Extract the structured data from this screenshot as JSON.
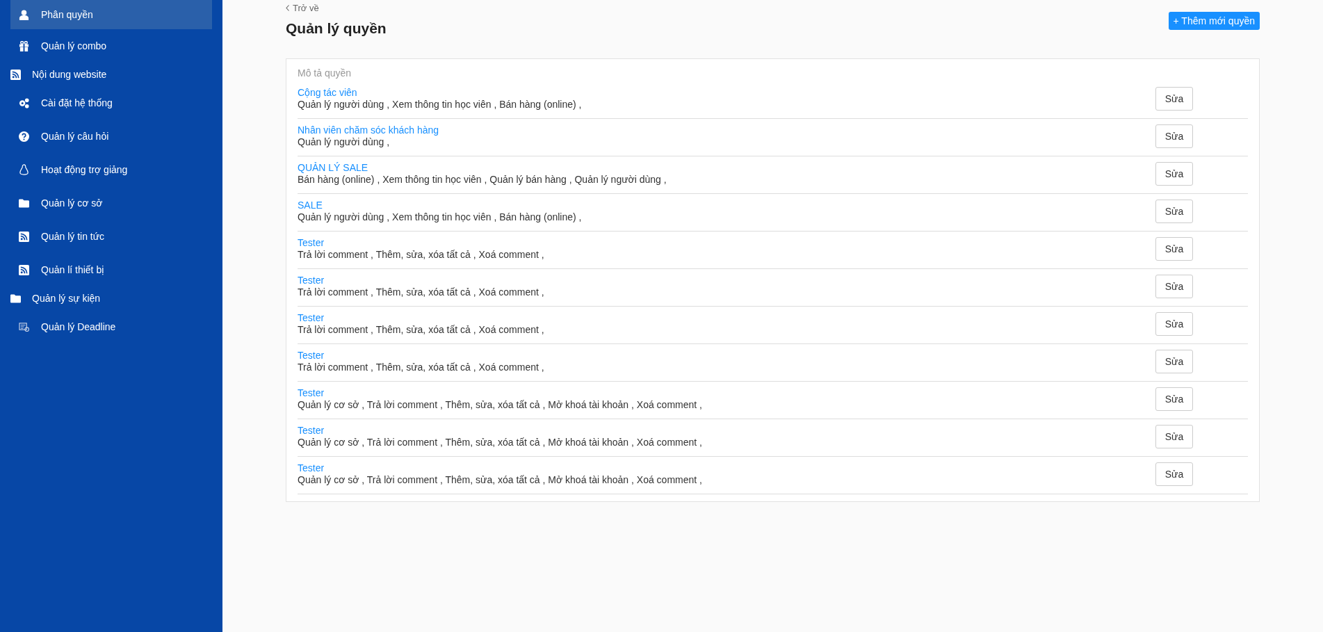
{
  "sidebar": {
    "items": [
      {
        "label": "Phân quyền",
        "selected": true
      },
      {
        "label": "Quản lý combo",
        "selected": false
      },
      {
        "label": "Nội dung website",
        "selected": false
      },
      {
        "label": "Cài đặt hệ thống",
        "selected": false
      },
      {
        "label": "Quản lý câu hỏi",
        "selected": false
      },
      {
        "label": "Hoạt động trợ giảng",
        "selected": false
      },
      {
        "label": "Quản lý cơ sở",
        "selected": false
      },
      {
        "label": "Quản lý tin tức",
        "selected": false
      },
      {
        "label": "Quản lí thiết bị",
        "selected": false
      },
      {
        "label": "Quản lý sự kiện",
        "selected": false
      },
      {
        "label": "Quản lý Deadline",
        "selected": false
      }
    ]
  },
  "back_link": "Trở về",
  "title": "Quản lý quyền",
  "add_button": "+ Thêm mới quyền",
  "table": {
    "column_header": "Mô tả quyền",
    "rows": [
      {
        "name": "Cộng tác viên",
        "permissions": "Quản lý người dùng , Xem thông tin học viên , Bán hàng (online) ,",
        "action": "Sửa"
      },
      {
        "name": "Nhân viên chăm sóc khách hàng",
        "permissions": "Quản lý người dùng ,",
        "action": "Sửa"
      },
      {
        "name": "QUẢN LÝ SALE",
        "permissions": "Bán hàng (online) , Xem thông tin học viên , Quản lý bán hàng , Quản lý người dùng ,",
        "action": "Sửa"
      },
      {
        "name": "SALE",
        "permissions": "Quản lý người dùng , Xem thông tin học viên , Bán hàng (online) ,",
        "action": "Sửa"
      },
      {
        "name": "Tester",
        "permissions": "Trả lời comment , Thêm, sửa, xóa tất cả , Xoá comment ,",
        "action": "Sửa"
      },
      {
        "name": "Tester",
        "permissions": "Trả lời comment , Thêm, sửa, xóa tất cả , Xoá comment ,",
        "action": "Sửa"
      },
      {
        "name": "Tester",
        "permissions": "Trả lời comment , Thêm, sửa, xóa tất cả , Xoá comment ,",
        "action": "Sửa"
      },
      {
        "name": "Tester",
        "permissions": "Trả lời comment , Thêm, sửa, xóa tất cả , Xoá comment ,",
        "action": "Sửa"
      },
      {
        "name": "Tester",
        "permissions": "Quản lý cơ sở , Trả lời comment , Thêm, sửa, xóa tất cả , Mở khoá tài khoản , Xoá comment ,",
        "action": "Sửa"
      },
      {
        "name": "Tester",
        "permissions": "Quản lý cơ sở , Trả lời comment , Thêm, sửa, xóa tất cả , Mở khoá tài khoản , Xoá comment ,",
        "action": "Sửa"
      },
      {
        "name": "Tester",
        "permissions": "Quản lý cơ sở , Trả lời comment , Thêm, sửa, xóa tất cả , Mở khoá tài khoản , Xoá comment ,",
        "action": "Sửa"
      }
    ]
  }
}
